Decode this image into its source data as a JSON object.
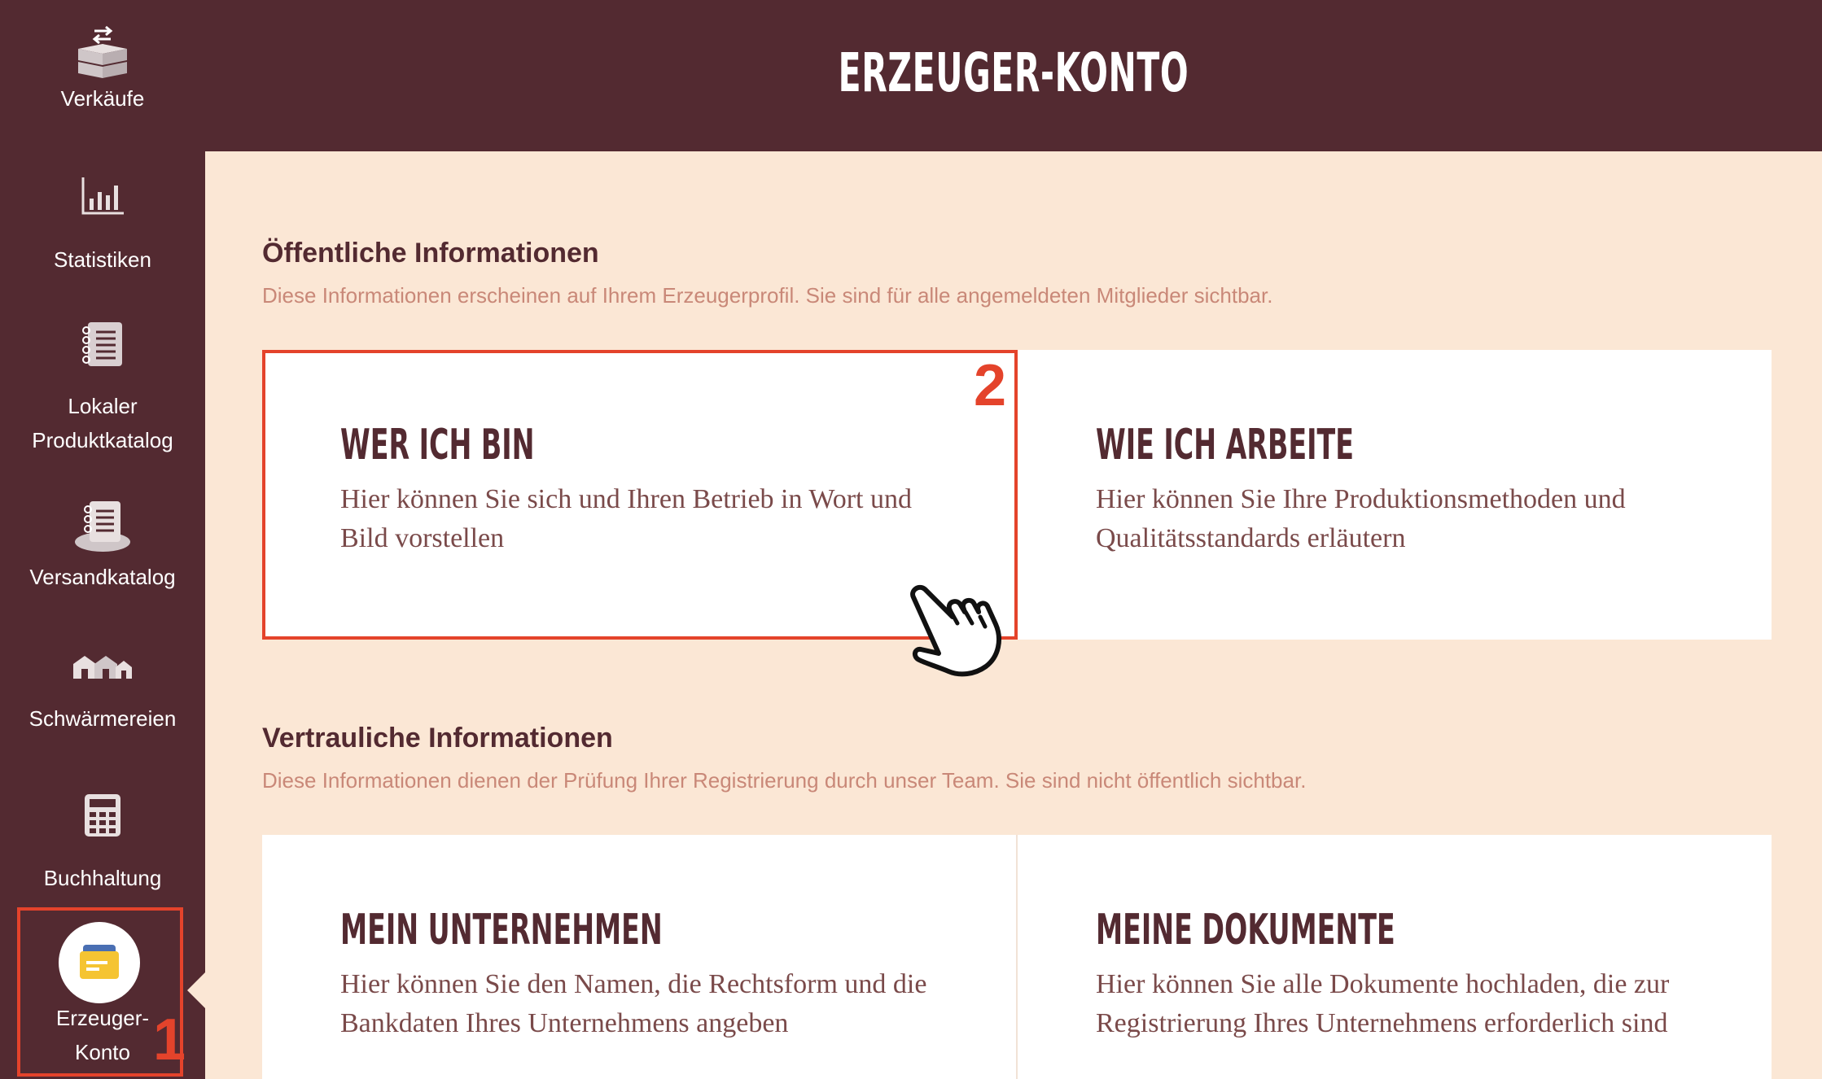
{
  "header": {
    "title": "ERZEUGER-KONTO"
  },
  "sidebar": {
    "items": [
      {
        "label": "Verkäufe"
      },
      {
        "label": "Statistiken"
      },
      {
        "label_line1": "Lokaler",
        "label_line2": "Produktkatalog"
      },
      {
        "label": "Versandkatalog"
      },
      {
        "label": "Schwärmereien"
      },
      {
        "label": "Buchhaltung"
      },
      {
        "label_line1": "Erzeuger-",
        "label_line2": "Konto",
        "active": true
      }
    ],
    "marker": "1"
  },
  "public_section": {
    "title": "Öffentliche Informationen",
    "description": "Diese Informationen erscheinen auf Ihrem Erzeugerprofil. Sie sind für alle angemeldeten Mitglieder sichtbar.",
    "cards": [
      {
        "title": "WER ICH BIN",
        "description": "Hier können Sie sich und Ihren Betrieb in Wort und Bild vorstellen"
      },
      {
        "title": "WIE ICH ARBEITE",
        "description": "Hier können Sie Ihre Produktionsmethoden und Qualitätsstandards erläutern"
      }
    ],
    "marker": "2"
  },
  "private_section": {
    "title": "Vertrauliche Informationen",
    "description": "Diese Informationen dienen der Prüfung Ihrer Registrierung durch unser Team. Sie sind nicht öffentlich sichtbar.",
    "cards": [
      {
        "title": "MEIN UNTERNEHMEN",
        "description": "Hier können Sie den Namen, die Rechtsform und die Bankdaten Ihres Unternehmens angeben"
      },
      {
        "title": "MEINE DOKUMENTE",
        "description": "Hier können Sie alle Dokumente hochladen, die zur Registrierung Ihres Unternehmens erforderlich sind"
      }
    ]
  },
  "colors": {
    "brand": "#532a31",
    "background": "#fbe7d5",
    "highlight": "#e4432b",
    "muted_text": "#c98878"
  }
}
